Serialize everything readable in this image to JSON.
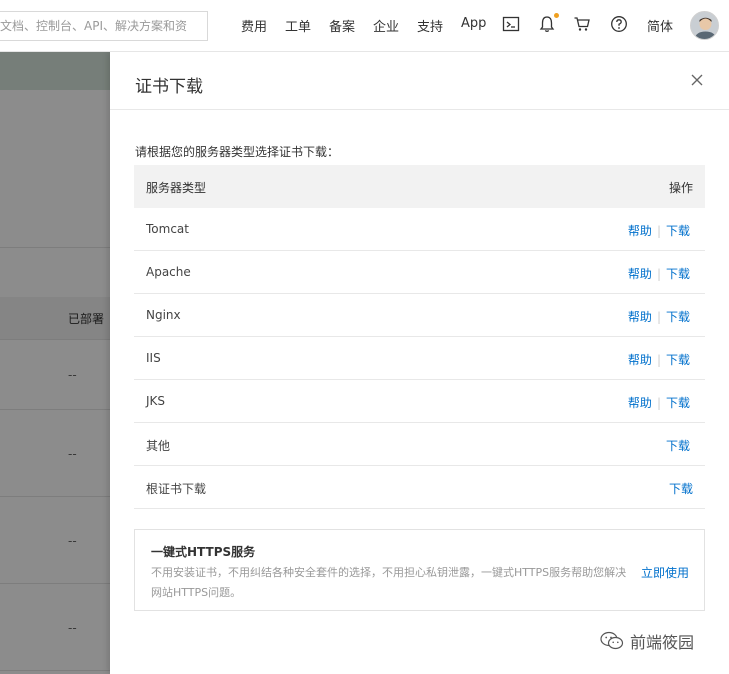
{
  "topbar": {
    "search_placeholder": "文档、控制台、API、解决方案和资",
    "nav": [
      "费用",
      "工单",
      "备案",
      "企业",
      "支持",
      "App"
    ],
    "lang": "简体"
  },
  "background": {
    "header_text": "已部署",
    "cells": [
      "--",
      "--",
      "--",
      "--"
    ]
  },
  "drawer": {
    "title": "证书下载",
    "intro": "请根据您的服务器类型选择证书下载：",
    "table": {
      "col_server": "服务器类型",
      "col_action": "操作",
      "rows": [
        {
          "name": "Tomcat",
          "help": "帮助",
          "download": "下载"
        },
        {
          "name": "Apache",
          "help": "帮助",
          "download": "下载"
        },
        {
          "name": "Nginx",
          "help": "帮助",
          "download": "下载"
        },
        {
          "name": "IIS",
          "help": "帮助",
          "download": "下载"
        },
        {
          "name": "JKS",
          "help": "帮助",
          "download": "下载"
        },
        {
          "name": "其他",
          "download": "下载"
        },
        {
          "name": "根证书下载",
          "download": "下载"
        }
      ]
    },
    "promo": {
      "title": "一键式HTTPS服务",
      "desc": "不用安装证书，不用纠结各种安全套件的选择，不用担心私钥泄露，一键式HTTPS服务帮助您解决网站HTTPS问题。",
      "link": "立即使用"
    }
  },
  "watermark": "前端筱园",
  "colors": {
    "link": "#0070cc",
    "notification_dot": "#f0a020"
  }
}
